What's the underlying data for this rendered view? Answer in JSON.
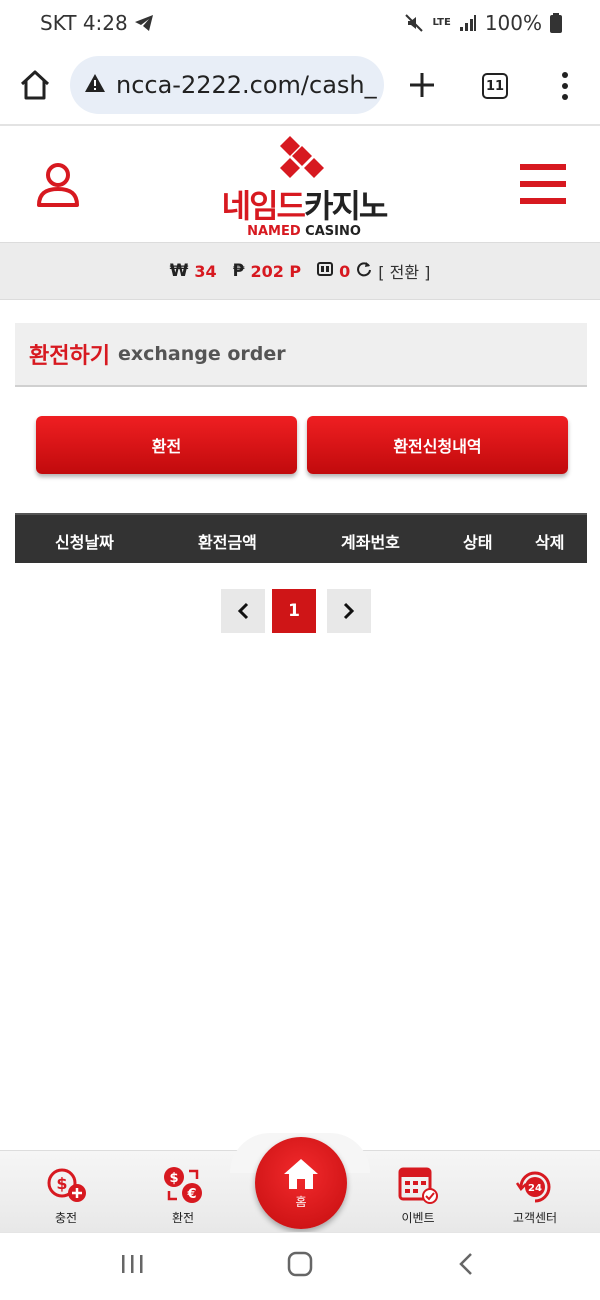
{
  "status_bar": {
    "carrier_time": "SKT 4:28",
    "lte": "LTE",
    "battery": "100%"
  },
  "browser": {
    "url": "ncca-2222.com/cash_",
    "tab_count": "11"
  },
  "site": {
    "logo_ko_red": "네임드",
    "logo_ko_dark": "카지노",
    "logo_en_red": "NAMED",
    "logo_en_dark": " CASINO"
  },
  "balance": {
    "won_symbol": "₩",
    "won_value": "34",
    "point_symbol": "₱",
    "point_value": "202 P",
    "chip_value": "0",
    "swap_label": "[ 전환 ]"
  },
  "title": {
    "ko": "환전하기",
    "en": "exchange order"
  },
  "buttons": {
    "exchange": "환전",
    "history": "환전신청내역"
  },
  "table": {
    "headers": [
      "신청날짜",
      "환전금액",
      "계좌번호",
      "상태",
      "삭제"
    ]
  },
  "pagination": {
    "current": "1"
  },
  "bottom_nav": {
    "charge": "충전",
    "exchange": "환전",
    "home": "홈",
    "event": "이벤트",
    "support": "고객센터"
  },
  "colors": {
    "brand_red": "#d71920",
    "table_header": "#333333"
  }
}
